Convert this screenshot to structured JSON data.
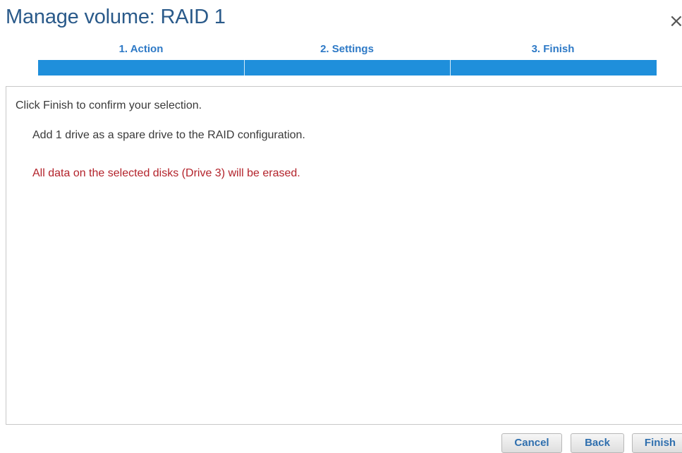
{
  "dialog": {
    "title": "Manage volume: RAID 1",
    "close_glyph": "×"
  },
  "steps": [
    {
      "label": "1. Action"
    },
    {
      "label": "2. Settings"
    },
    {
      "label": "3. Finish"
    }
  ],
  "content": {
    "instruction": "Click Finish to confirm your selection.",
    "detail": "Add 1 drive as a spare drive to the RAID configuration.",
    "warning": "All data on the selected disks (Drive 3) will be erased."
  },
  "buttons": {
    "cancel": "Cancel",
    "back": "Back",
    "finish": "Finish"
  },
  "colors": {
    "title": "#2a5a8a",
    "step_label": "#2d79c6",
    "step_bar": "#1f8fdb",
    "warning": "#b3232b",
    "button_text": "#2f6fae"
  },
  "icons": {
    "close": "close-icon"
  }
}
